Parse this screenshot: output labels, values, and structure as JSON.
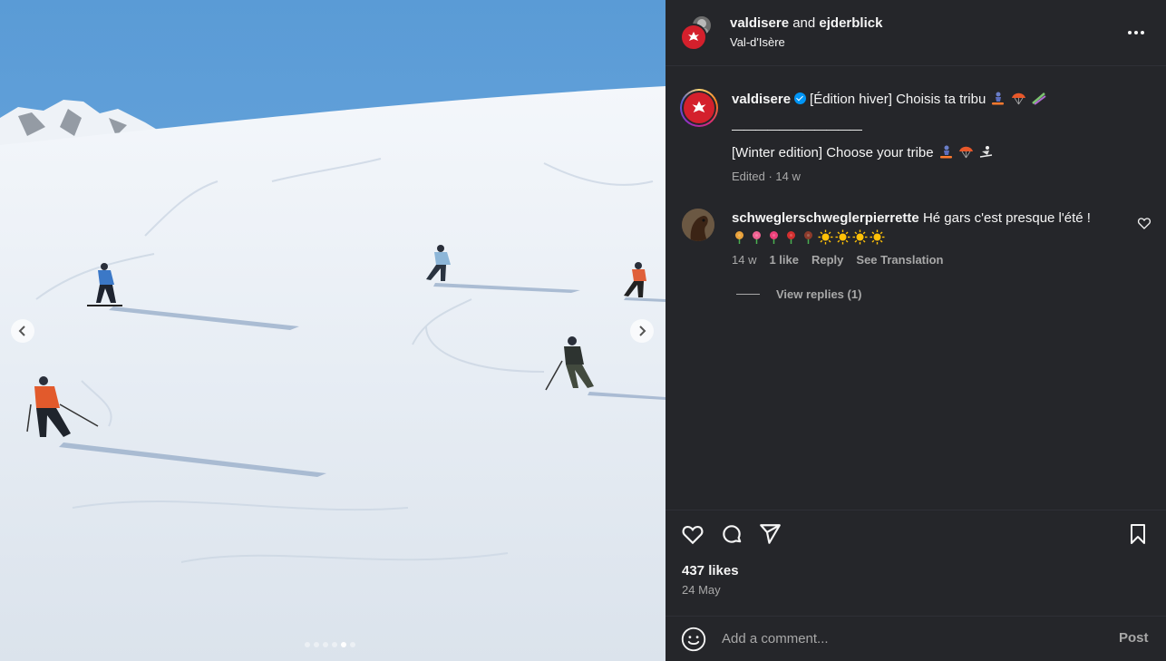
{
  "header": {
    "user1": "valdisere",
    "joiner": "and",
    "user2": "ejderblick",
    "location": "Val-d'Isère",
    "more_icon": "more-horizontal-icon"
  },
  "caption": {
    "username": "valdisere",
    "text_fr": "[Édition hiver] Choisis ta tribu",
    "divider": "———————————",
    "text_en": "[Winter edition] Choose your tribe",
    "meta": "Edited · 14 w",
    "emojis": [
      "snowboarder",
      "parachute",
      "ski"
    ]
  },
  "comment": {
    "username": "schweglerschweglerpierrette",
    "text": "Hé gars c'est presque l'été !",
    "emojis": [
      "bouquet",
      "hibiscus",
      "tulip",
      "rose",
      "wilted-flower",
      "sun",
      "sun",
      "sun",
      "sun"
    ],
    "time": "14 w",
    "likes": "1 like",
    "reply": "Reply",
    "translate": "See Translation",
    "view_replies": "View replies (1)"
  },
  "actions": {
    "like_icon": "heart-icon",
    "comment_icon": "comment-icon",
    "share_icon": "share-icon",
    "save_icon": "bookmark-icon"
  },
  "likes": "437 likes",
  "date": "24 May",
  "add_comment": {
    "placeholder": "Add a comment...",
    "post_label": "Post"
  },
  "carousel": {
    "total": 6,
    "active_index": 4
  },
  "colors": {
    "panel_bg": "#25262a",
    "brand_red": "#d4202c",
    "verified_blue": "#0095f6",
    "muted_text": "#a8a8a8"
  }
}
